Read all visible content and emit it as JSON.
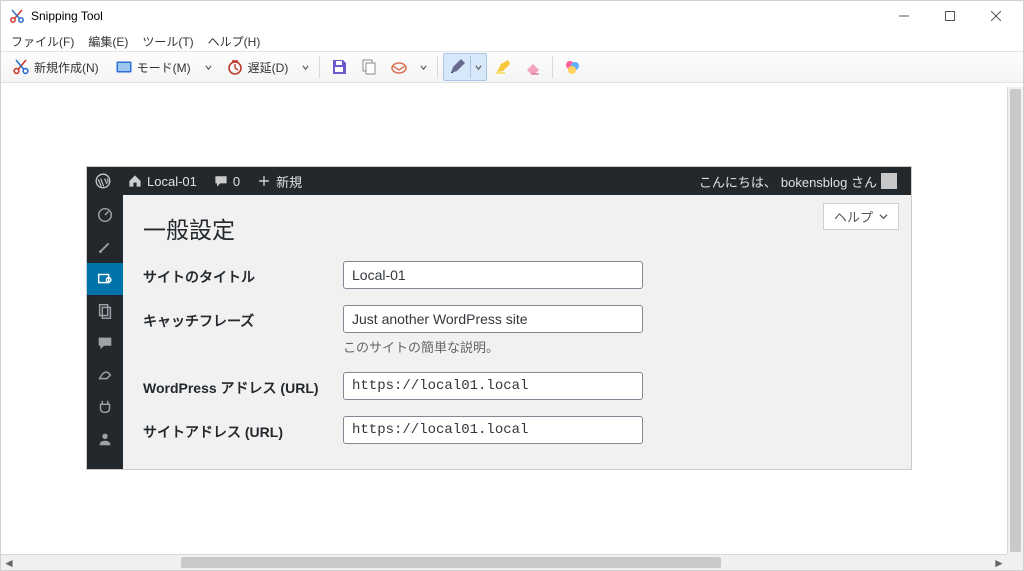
{
  "app": {
    "title": "Snipping Tool"
  },
  "menubar": {
    "file": "ファイル(F)",
    "edit": "編集(E)",
    "tools": "ツール(T)",
    "help": "ヘルプ(H)"
  },
  "toolbar": {
    "new": "新規作成(N)",
    "mode": "モード(M)",
    "delay": "遅延(D)"
  },
  "wp": {
    "adminbar": {
      "site_name": "Local-01",
      "comments": "0",
      "new": "新規",
      "greeting_prefix": "こんにちは、",
      "greeting_user": "bokensblog さん"
    },
    "help_label": "ヘルプ",
    "page_title": "一般設定",
    "fields": {
      "site_title": {
        "label": "サイトのタイトル",
        "value": "Local-01"
      },
      "tagline": {
        "label": "キャッチフレーズ",
        "value": "Just another WordPress site",
        "description": "このサイトの簡単な説明。"
      },
      "wp_url": {
        "label": "WordPress アドレス (URL)",
        "value": "https://local01.local"
      },
      "site_url": {
        "label": "サイトアドレス (URL)",
        "value": "https://local01.local"
      }
    }
  }
}
